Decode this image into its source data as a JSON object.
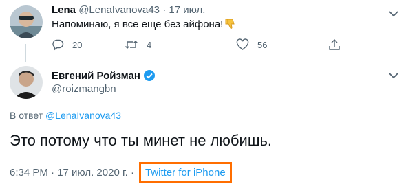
{
  "reply": {
    "name": "Lena",
    "handle": "@LenaIvanova43",
    "separator": "·",
    "date": "17 июл.",
    "text": "Напоминаю, я все еще без айфона!",
    "emoji_icon": "thumbs-down-icon",
    "actions": {
      "reply_count": "20",
      "retweet_count": "4",
      "like_count": "56"
    }
  },
  "main": {
    "name": "Евгений Ройзман",
    "handle": "@roizmangbn",
    "reply_prefix": "В ответ",
    "reply_handle": "@LenaIvanova43",
    "text": "Это потому что ты минет не любишь.",
    "timestamp": "6:34 PM · 17 июл. 2020 г. ·",
    "source": "Twitter for iPhone"
  },
  "colors": {
    "link": "#1d9bf0",
    "muted": "#536471",
    "highlight_box": "#ff6e00",
    "verified": "#1d9bf0"
  }
}
